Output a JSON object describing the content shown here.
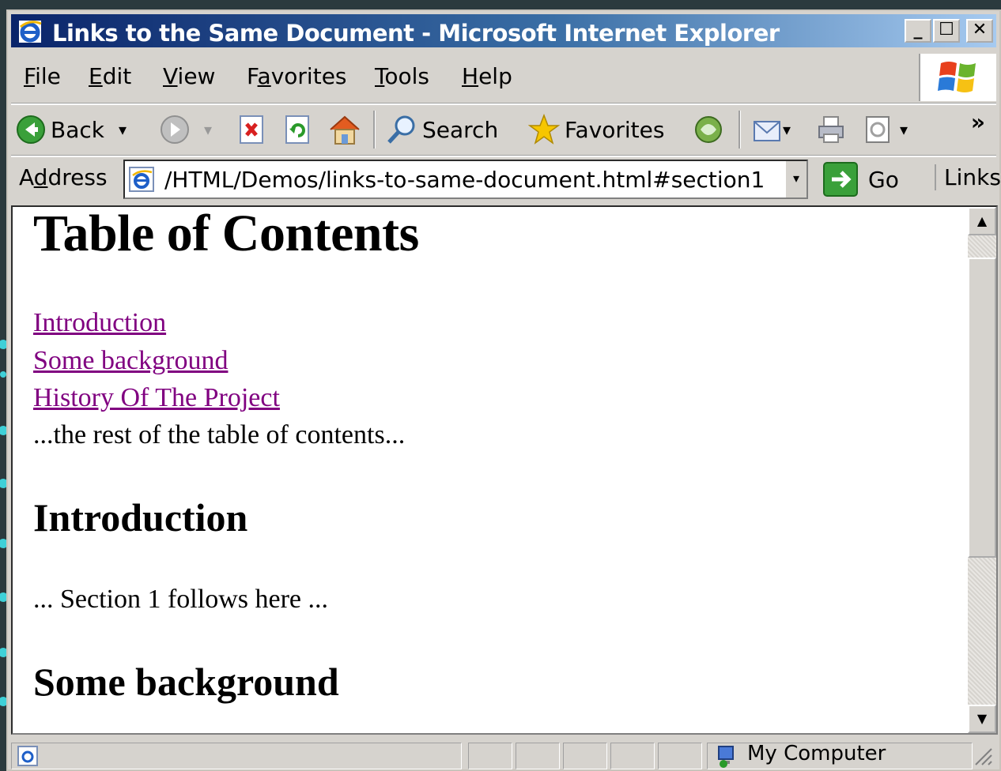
{
  "window": {
    "title": "Links to the Same Document - Microsoft Internet Explorer",
    "minimize_label": "_",
    "maximize_label": "☐",
    "close_label": "✕"
  },
  "menu": {
    "items": [
      {
        "key": "F",
        "rest": "ile"
      },
      {
        "key": "E",
        "rest": "dit"
      },
      {
        "key": "V",
        "rest": "iew"
      },
      {
        "pre": "F",
        "key": "a",
        "rest": "vorites"
      },
      {
        "key": "T",
        "rest": "ools"
      },
      {
        "key": "H",
        "rest": "elp"
      }
    ]
  },
  "toolbar": {
    "back_label": "Back",
    "search_label": "Search",
    "favorites_label": "Favorites",
    "chevron": "»",
    "dropdown_arrow": "▾"
  },
  "address": {
    "label_pre": "A",
    "label_key": "d",
    "label_rest": "dress",
    "url": "/HTML/Demos/links-to-same-document.html#section1",
    "go_label": "Go",
    "links_label": "Links"
  },
  "page": {
    "heading": "Table of Contents",
    "toc_links": [
      "Introduction",
      "Some background",
      "History Of The Project"
    ],
    "toc_rest": "...the rest of the table of contents...",
    "section1_heading": "Introduction",
    "section1_text": "... Section 1 follows here ...",
    "section2_heading": "Some background"
  },
  "status": {
    "zone_label": "My Computer"
  },
  "colors": {
    "visited_link": "#800080",
    "title_bar_start": "#0a246a",
    "title_bar_end": "#a6caf0",
    "chrome": "#d6d3ce"
  }
}
